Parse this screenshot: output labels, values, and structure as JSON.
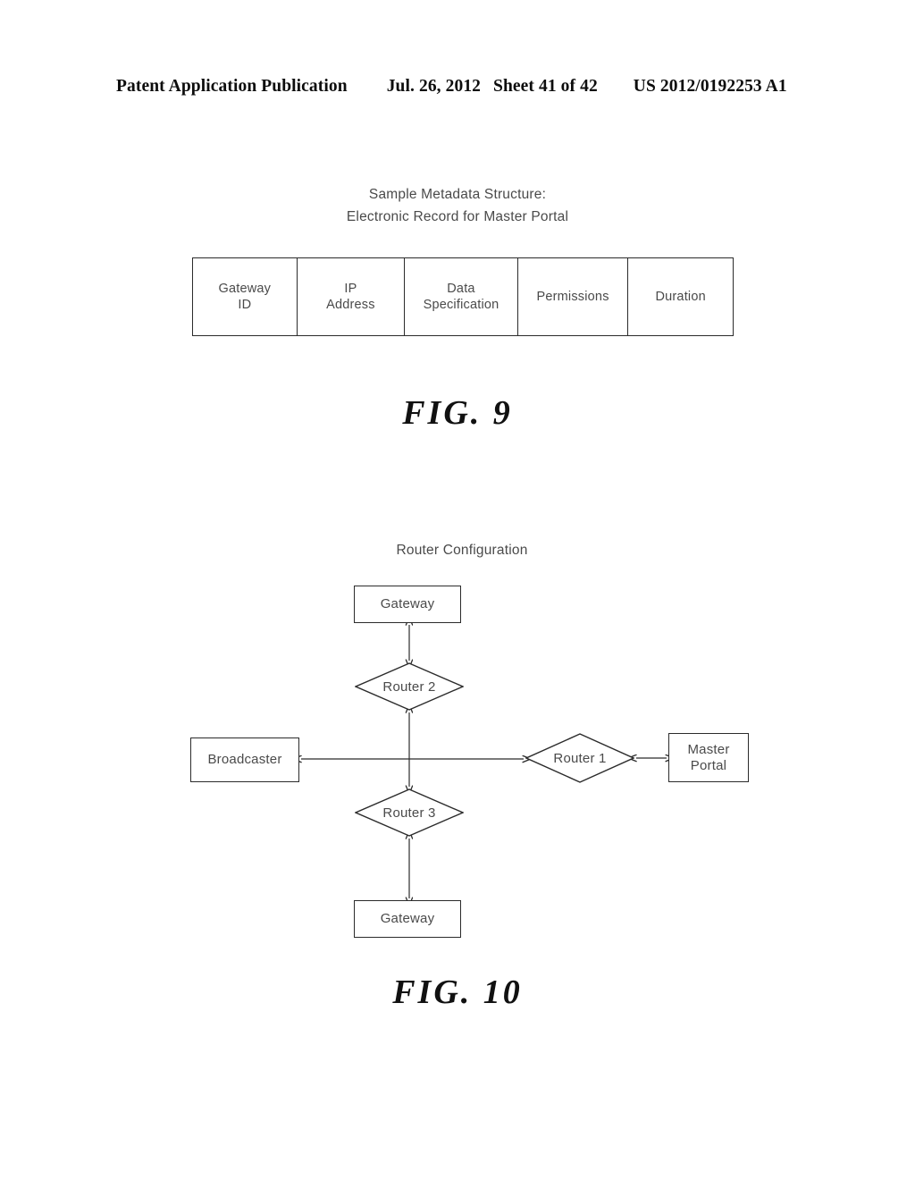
{
  "header": {
    "publication": "Patent Application Publication",
    "date": "Jul. 26, 2012",
    "sheet": "Sheet 41 of 42",
    "patent_number": "US 2012/0192253 A1"
  },
  "figure9": {
    "title_line1": "Sample Metadata Structure:",
    "title_line2": "Electronic Record for Master Portal",
    "figure_label": "FIG.  9",
    "table": {
      "columns": [
        {
          "line1": "Gateway",
          "line2": "ID"
        },
        {
          "line1": "IP",
          "line2": "Address"
        },
        {
          "line1": "Data",
          "line2": "Specification"
        },
        {
          "line1": "Permissions",
          "line2": ""
        },
        {
          "line1": "Duration",
          "line2": ""
        }
      ]
    }
  },
  "figure10": {
    "title": "Router Configuration",
    "figure_label": "FIG.  10",
    "nodes": {
      "gateway_top": {
        "line1": "Gateway",
        "line2": ""
      },
      "router2": "Router 2",
      "broadcaster": {
        "line1": "Broadcaster",
        "line2": ""
      },
      "router1": "Router 1",
      "master_portal": {
        "line1": "Master",
        "line2": "Portal"
      },
      "router3": "Router 3",
      "gateway_bottom": {
        "line1": "Gateway",
        "line2": ""
      }
    }
  },
  "colors": {
    "ink": "#2b2b2b",
    "text": "#4a4a4a",
    "background": "#ffffff"
  }
}
